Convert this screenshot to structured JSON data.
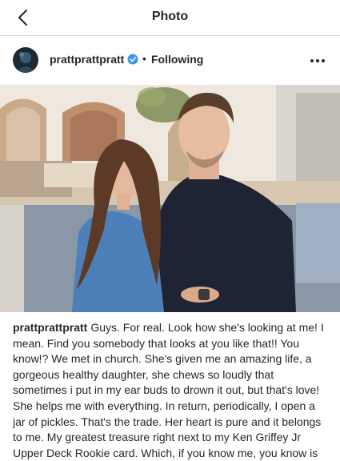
{
  "topbar": {
    "title": "Photo",
    "back_icon": "chevron-left-icon"
  },
  "post": {
    "username": "prattprattpratt",
    "verified": true,
    "separator": "•",
    "follow_status": "Following",
    "more_icon": "more-horizontal-icon"
  },
  "caption": {
    "username": "prattprattpratt",
    "text": "Guys. For real. Look how she's looking at me! I mean. Find you somebody that looks at you like that!! You know!? We met in church. She's given me an amazing life, a gorgeous healthy daughter, she chews so loudly that sometimes i put in my ear buds to drown it out, but that's love! She helps me with everything. In return, periodically, I open a jar of pickles. That's the trade. Her heart is pure and it belongs to me. My greatest treasure right next to my Ken Griffey Jr Upper Deck Rookie card. Which, if you know me, you know is"
  },
  "colors": {
    "verified_blue": "#3897f0",
    "text": "#262626",
    "border": "#dbdbdb"
  }
}
